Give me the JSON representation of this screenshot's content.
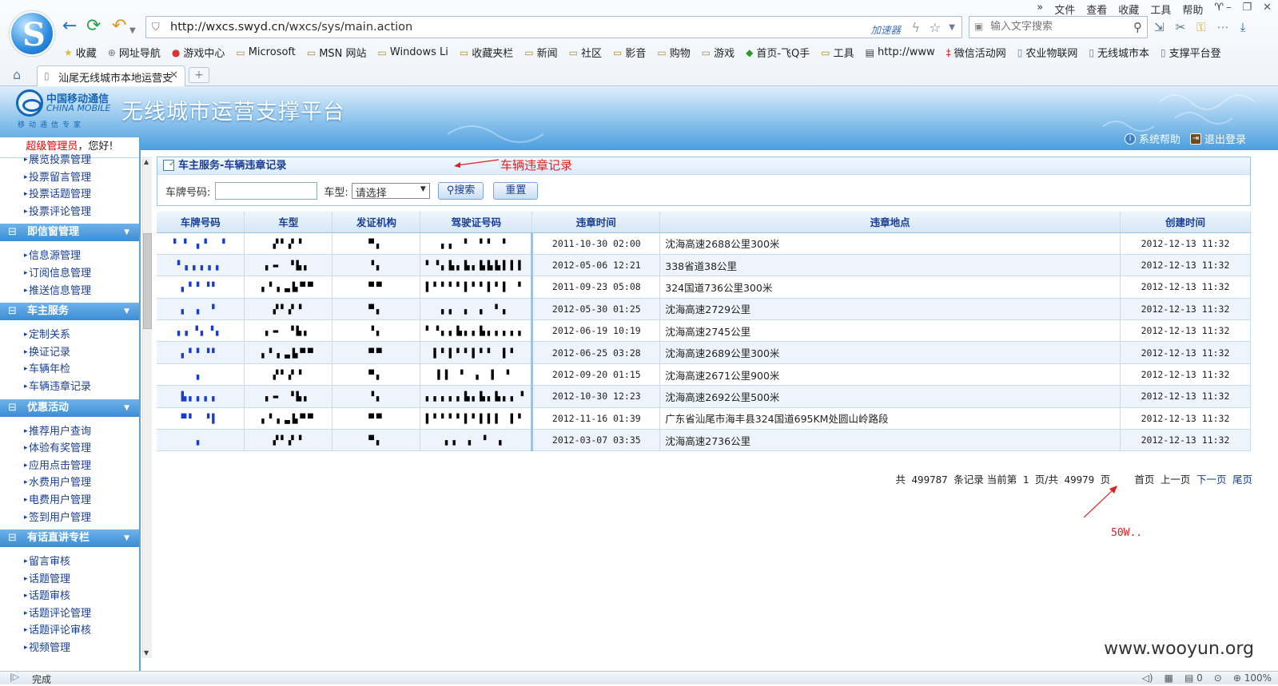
{
  "browser": {
    "url_host": "http://wxcs.swyd.cn",
    "url_path": "/wxcs/sys/main.action",
    "accelerator": "加速器",
    "search_placeholder": "输入文字搜索",
    "menu": [
      "»",
      "文件",
      "查看",
      "收藏",
      "工具",
      "帮助"
    ],
    "favorites": [
      "收藏",
      "网址导航",
      "游戏中心",
      "Microsoft",
      "MSN 网站",
      "Windows Li",
      "收藏夹栏",
      "新闻",
      "社区",
      "影音",
      "购物",
      "游戏",
      "首页-飞Q手",
      "工具",
      "http://www",
      "微信活动网",
      "农业物联网",
      "无线城市本",
      "支撑平台登"
    ],
    "tab_title": "汕尾无线城市本地运营支",
    "status_text": "完成",
    "status_zoom": "100%",
    "status_count": "0"
  },
  "banner": {
    "cm_cn": "中国移动通信",
    "cm_en": "CHINA MOBILE",
    "cm_slogan": "移动通信专家",
    "title": "无线城市运营支撑平台",
    "help": "系统帮助",
    "logout": "退出登录"
  },
  "sidebar": {
    "greet_role": "超级管理员",
    "greet_text": "，您好!",
    "groups": [
      {
        "label": null,
        "items": [
          "展览投票管理",
          "投票留言管理",
          "投票话题管理",
          "投票评论管理"
        ]
      },
      {
        "label": "即信窗管理",
        "items": [
          "信息源管理",
          "订阅信息管理",
          "推送信息管理"
        ]
      },
      {
        "label": "车主服务",
        "items": [
          "定制关系",
          "换证记录",
          "车辆年检",
          "车辆违章记录"
        ]
      },
      {
        "label": "优惠活动",
        "items": [
          "推荐用户查询",
          "体验有奖管理",
          "应用点击管理",
          "水费用户管理",
          "电费用户管理",
          "签到用户管理"
        ]
      },
      {
        "label": "有话直讲专栏",
        "items": [
          "留言审核",
          "话题管理",
          "话题审核",
          "话题评论管理",
          "话题评论审核",
          "视频管理"
        ]
      }
    ]
  },
  "panel": {
    "title": "车主服务-车辆违章记录",
    "plate_label": "车牌号码:",
    "type_label": "车型:",
    "type_selected": "请选择",
    "search_btn": "搜索",
    "reset_btn": "重置",
    "annotation": "车辆违章记录"
  },
  "table": {
    "headers": [
      "车牌号码",
      "车型",
      "发证机构",
      "驾驶证号码",
      "违章时间",
      "违章地点",
      "创建时间"
    ],
    "rows": [
      {
        "plate": "▘▝ ▖▘ ▝",
        "type": "▞▘▞▝",
        "org": "▀▖",
        "license": "▖▖   ▘   ▘▘ ▘",
        "time": "2011-10-30 02:00",
        "place": "沈海高速2688公里300米",
        "created": "2012-12-13 11:32"
      },
      {
        "plate": "▘▖▖▖▖▖",
        "type": "▖▬ ▝▙▖",
        "org": "▝▖",
        "license": "▘▝▖▙▖▙▖▙▙▙▌▌▌",
        "time": "2012-05-06 12:21",
        "place": "338省道38公里",
        "created": "2012-12-13 11:32"
      },
      {
        "plate": "▖▘▘▝▘",
        "type": "▖▘▖▃▙▀▀",
        "org": "▀▀",
        "license": "▌▘▘▘▘▌▘▘▌▘▌ ▘",
        "time": "2011-09-23 05:08",
        "place": "324国道736公里300米",
        "created": "2012-12-13 11:32"
      },
      {
        "plate": "▖ ▖ ▘",
        "type": "▞▘▞▝",
        "org": "▀▖",
        "license": "▖▖  ▖ ▖   ▘▖",
        "time": "2012-05-30 01:25",
        "place": "沈海高速2729公里",
        "created": "2012-12-13 11:32"
      },
      {
        "plate": "▖▖▝▖▝▖",
        "type": "▖▬ ▝▙▖",
        "org": "▝▖",
        "license": "▘▝▖▖▙▖▖▙▖▖▖▖▖",
        "time": "2012-06-19 10:19",
        "place": "沈海高速2745公里",
        "created": "2012-12-13 11:32"
      },
      {
        "plate": "▖▘▘▝▘",
        "type": "▖▘▖▃▙▀▀",
        "org": "▀▀",
        "license": "▌▘▌▘▘▌▘▘ ▌▘",
        "time": "2012-06-25 03:28",
        "place": "沈海高速2689公里300米",
        "created": "2012-12-13 11:32"
      },
      {
        "plate": "▖",
        "type": "▞▘▞▝",
        "org": "▀▖",
        "license": "▌▌  ▘ ▖  ▌ ▘",
        "time": "2012-09-20 01:15",
        "place": "沈海高速2671公里900米",
        "created": "2012-12-13 11:32"
      },
      {
        "plate": "▙▖▖▖▖",
        "type": "▖▬ ▝▙▖",
        "org": "▝▖",
        "license": "▖▖▖▖▖▙▖▙▖▙▖▖▝",
        "time": "2012-10-30 12:23",
        "place": "沈海高速2692公里500米",
        "created": "2012-12-13 11:32"
      },
      {
        "plate": "▀▘ ▝▌",
        "type": "▖▘▖▃▙▀▀",
        "org": "▀▀",
        "license": "▌▘▘▘▘▌▘▌▌▌ ▌▘",
        "time": "2012-11-16 01:39",
        "place": "广东省汕尾市海丰县324国道695KM处圆山岭路段",
        "created": "2012-12-13 11:32"
      },
      {
        "plate": "▖",
        "type": "▞▘▞▝",
        "org": "▀▖",
        "license": "▖▖ ▖ ▘       ▖",
        "time": "2012-03-07 03:35",
        "place": "沈海高速2736公里",
        "created": "2012-12-13 11:32"
      }
    ]
  },
  "pager": {
    "total_prefix": "共",
    "total": "499787",
    "total_suffix": "条记录 当前第",
    "current": "1",
    "of": "页/共",
    "pages": "49979",
    "pages_suffix": "页",
    "first": "首页",
    "prev": "上一页",
    "next": "下一页",
    "last": "尾页"
  },
  "annotation2": "50W..",
  "watermark": "www.wooyun.org"
}
